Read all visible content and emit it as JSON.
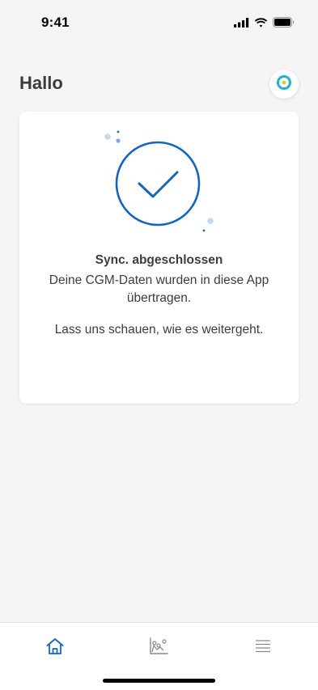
{
  "status_bar": {
    "time": "9:41",
    "icons": [
      "cellular-signal-icon",
      "wifi-icon",
      "battery-icon"
    ]
  },
  "header": {
    "greeting": "Hallo",
    "device_icon": "sensor-ring-icon"
  },
  "sync_card": {
    "icon": "checkmark-circle-icon",
    "title": "Sync. abgeschlossen",
    "message": "Deine CGM-Daten wurden in diese App übertragen.",
    "followup": "Lass uns schauen, wie es weitergeht."
  },
  "tab_bar": {
    "items": [
      {
        "icon": "home-icon",
        "active": true
      },
      {
        "icon": "chart-icon",
        "active": false
      },
      {
        "icon": "menu-icon",
        "active": false
      }
    ]
  },
  "colors": {
    "accent": "#1565c0",
    "sensor_teal": "#1fb5c5",
    "sensor_yellow": "#e5c21f",
    "background": "#f5f5f5",
    "inactive_icon": "#8a8a8a"
  }
}
